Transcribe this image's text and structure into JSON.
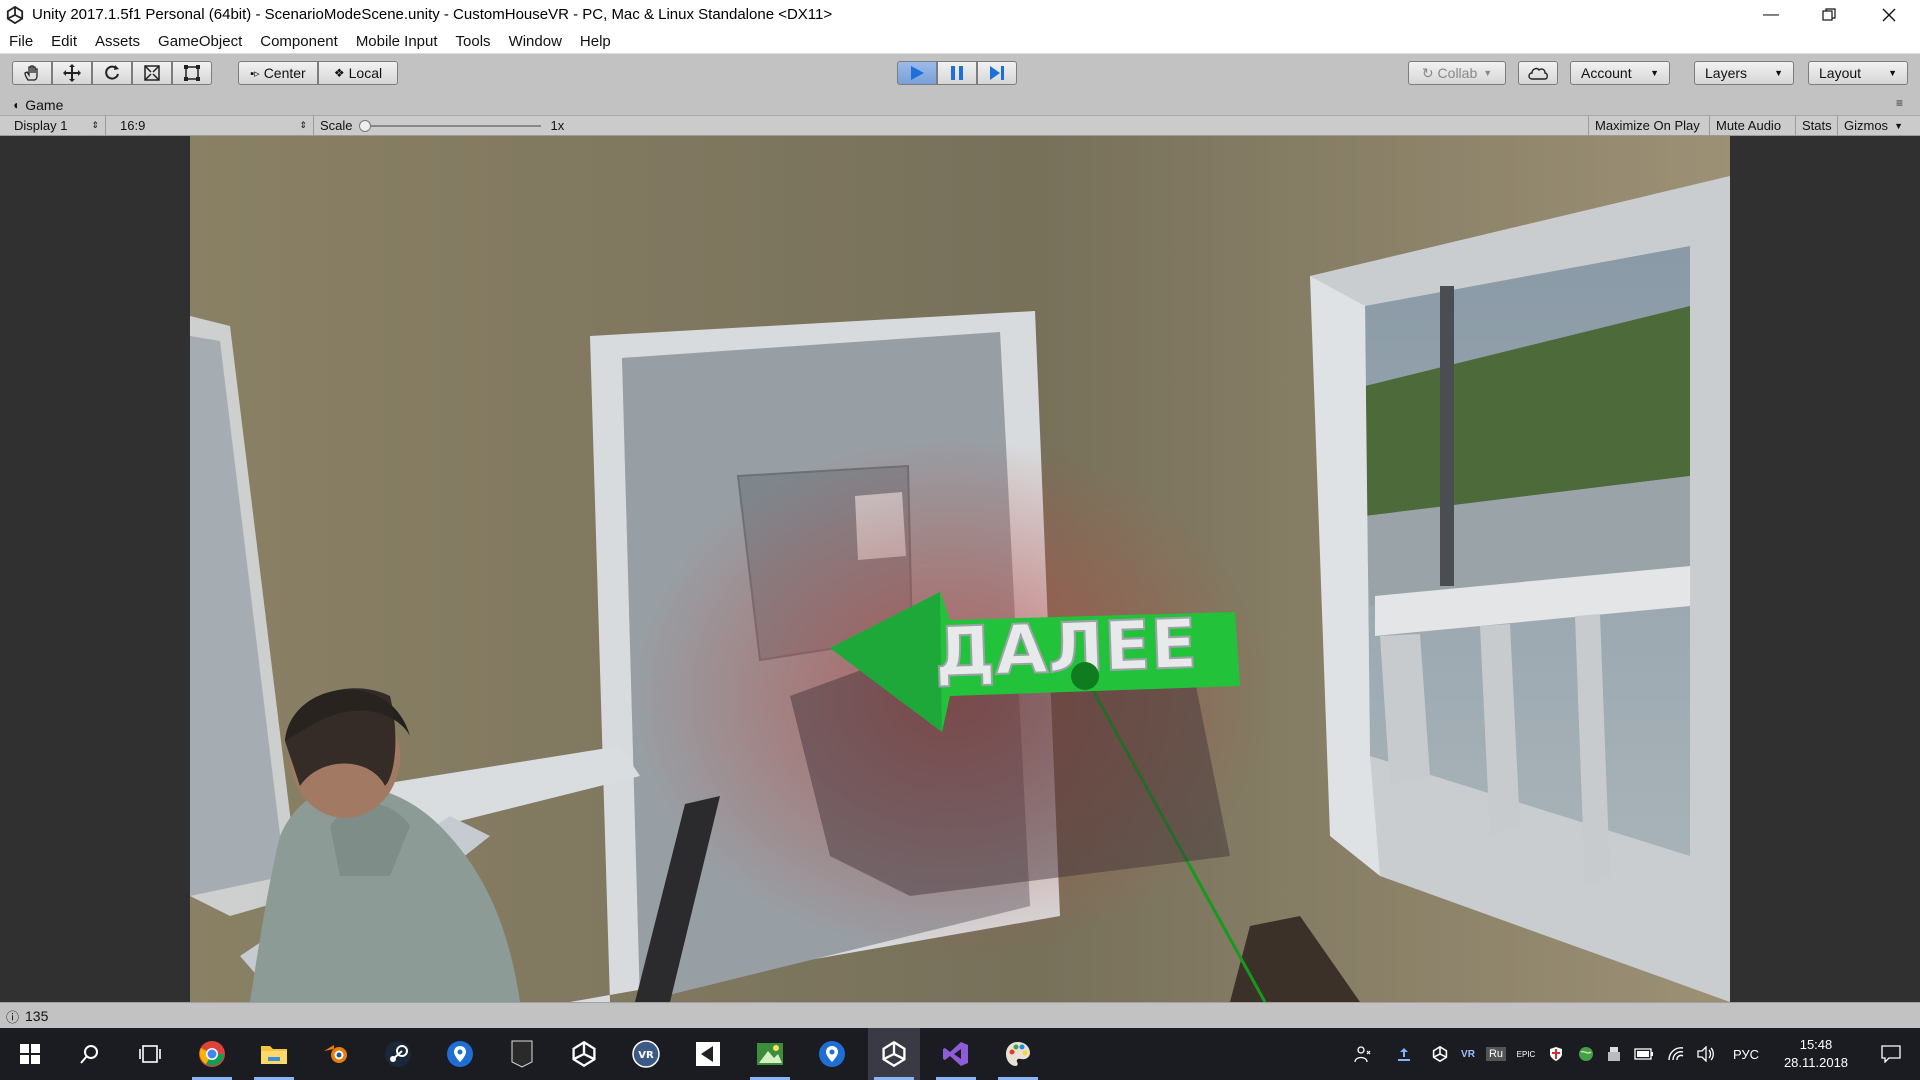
{
  "window": {
    "title": "Unity 2017.1.5f1 Personal (64bit) - ScenarioModeScene.unity - CustomHouseVR - PC, Mac & Linux Standalone <DX11>",
    "controls": [
      "minimize-icon",
      "restore-icon",
      "close-icon"
    ]
  },
  "menu": [
    "File",
    "Edit",
    "Assets",
    "GameObject",
    "Component",
    "Mobile Input",
    "Tools",
    "Window",
    "Help"
  ],
  "toolbar": {
    "tools": [
      "hand-tool-icon",
      "move-tool-icon",
      "rotate-tool-icon",
      "scale-tool-icon",
      "rect-tool-icon"
    ],
    "pivot_label": "Center",
    "space_label": "Local",
    "play_controls": [
      "play-icon",
      "pause-icon",
      "step-icon"
    ],
    "collab_label": "Collab",
    "account_label": "Account",
    "layers_label": "Layers",
    "layout_label": "Layout",
    "accent": "#1e6fd9"
  },
  "game_view": {
    "tab_label": "Game",
    "display_label": "Display 1",
    "aspect_label": "16:9",
    "scale_label": "Scale",
    "scale_value": "1x",
    "scale_fraction": 0.0,
    "toggles": [
      "Maximize On Play",
      "Mute Audio",
      "Stats",
      "Gizmos"
    ]
  },
  "scene": {
    "arrow_text": "ДАЛЕЕ",
    "arrow_color": "#22c23a",
    "pointer_color": "#159a1e"
  },
  "status": {
    "value": "135"
  },
  "taskbar": {
    "apps": [
      "windows-start-icon",
      "search-icon",
      "task-view-icon",
      "chrome-icon",
      "file-explorer-icon",
      "blender-icon",
      "steam-icon",
      "maps-pin-icon",
      "epic-games-icon",
      "unity-icon",
      "vr-icon",
      "unity-hub-icon",
      "image-editor-icon",
      "maps-pin-icon",
      "unity-icon",
      "visual-studio-icon",
      "paint-icon"
    ],
    "tray_language": "РУС",
    "time": "15:48",
    "date": "28.11.2018",
    "tray_vr": "VR",
    "tray_ru": "Ru",
    "tray_epic": "EPIC"
  }
}
